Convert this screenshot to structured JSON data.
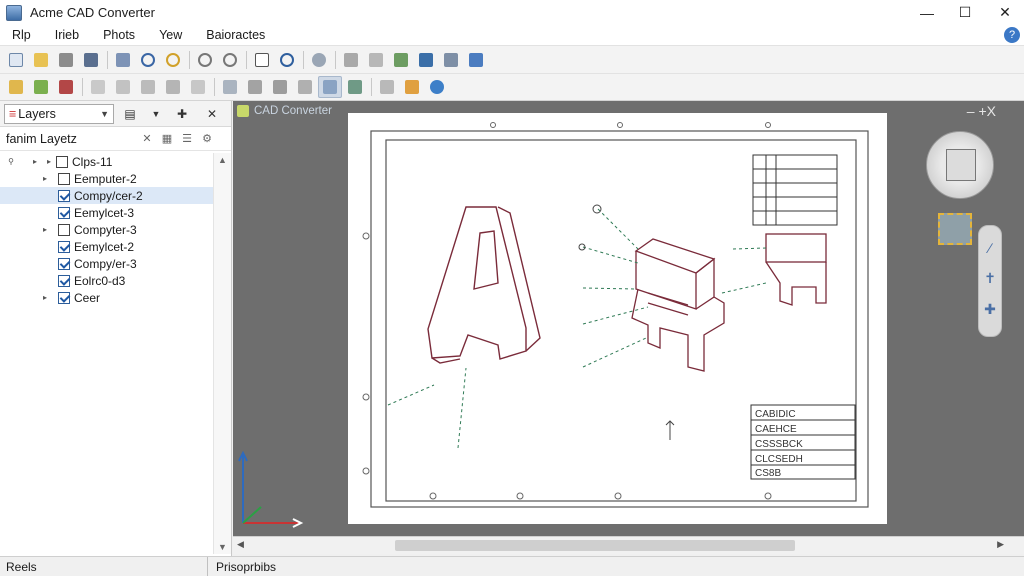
{
  "window": {
    "title": "Acme CAD Converter"
  },
  "menu": [
    "Rlp",
    "Irieb",
    "Phots",
    "Yew",
    "Baioractes"
  ],
  "layers_panel": {
    "dropdown_label": "Layers",
    "subheader": "fanim Layetz",
    "items": [
      {
        "label": "Clps-11",
        "checked": false,
        "expandable": true
      },
      {
        "label": "Eemputer-2",
        "checked": false,
        "expandable": true
      },
      {
        "label": "Compy/cer-2",
        "checked": true,
        "expandable": false,
        "selected": true
      },
      {
        "label": "Eemylcet-3",
        "checked": true,
        "expandable": false
      },
      {
        "label": "Compyter-3",
        "checked": false,
        "expandable": true
      },
      {
        "label": "Eemylcet-2",
        "checked": true,
        "expandable": false
      },
      {
        "label": "Compy/er-3",
        "checked": true,
        "expandable": false
      },
      {
        "label": "Eolrc0-d3",
        "checked": true,
        "expandable": false
      },
      {
        "label": "Ceer",
        "checked": true,
        "expandable": true
      }
    ]
  },
  "canvas": {
    "title": "CAD Converter",
    "controls": "– +X"
  },
  "status": {
    "left": "Reels",
    "right": "Prisoprbibs"
  },
  "title_block": [
    "CABIDIC",
    "CAEHCE",
    "CSSSBCK",
    "CLCSEDH",
    "CS8B"
  ],
  "colors": {
    "accent": "#3b78c6",
    "canvas_bg": "#6e6e6e",
    "drawing_line": "#7a2b3a"
  }
}
